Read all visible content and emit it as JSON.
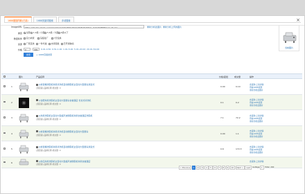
{
  "dialog": {
    "title": "选择数据",
    "close": "×"
  },
  "tabs": [
    "1688图搜同款(已选)",
    "1688关键词搜索",
    "手动搜索"
  ],
  "form": {
    "image_label": "ImageURL",
    "image_url": "https://cbu01.alicdn.com/img/ibank/O1CN01pNAhnR1Bq6cDfgm_!!2216786811-0-cib.jpg",
    "image_links": [
      "重新分析此图片",
      "重新分析上传的图片"
    ],
    "category_label": "类目",
    "category_options": [
      "全部",
      "1-2级 / 小图",
      "3-4级 / 大图",
      "4级以下"
    ],
    "filter_label": "筛选条件",
    "filter_options": [
      "实力商家",
      "深度验厂",
      "7天包换"
    ],
    "supply_label": "货源",
    "supply_options": [
      "厂家直供",
      "一件代发",
      "支持混批",
      "已开通跨境"
    ],
    "price_label": "价格",
    "price_from": "0",
    "price_to": "999",
    "price_ranges": [
      "0.01-0.50",
      "0.51-1.00",
      "1.01-5.00",
      "5.01-20.00",
      "20.01-50.00"
    ],
    "search_button": "搜索",
    "reset_link": "+ 1688高级搜索"
  },
  "preview": {
    "caption": "当前图片"
  },
  "table": {
    "headers": [
      "图片",
      "产品名称",
      "价格/起批",
      "成交量",
      "操作"
    ],
    "rows": [
      {
        "index": "1",
        "title": "[]前置桶洗碗机商用清洗机自动刷碗机全自动大型厨房通道式",
        "sub": "[源店铺] 品牌名称  成交量: 0",
        "price": "0.00",
        "qty": "0.10",
        "actions": [
          "去采购 上架详情",
          "查看1688货源",
          "重新分析此图片"
        ]
      },
      {
        "index": "2",
        "title": "[]合肥商用洗碗机全自动大型厨房食堂酒店 长龙式清洗机",
        "sub": "[源店铺] 品牌名称  成交量: 0",
        "price": "0.1",
        "qty": "0.2",
        "actions": [
          "去采购 上架详情",
          "查看1688货源",
          "重新分析此图片"
        ]
      },
      {
        "index": "3",
        "title": "[]商用洗碗机全自动大型超声波刷碗机商用食堂酒店洗碗机",
        "sub": "[源店铺] 品牌名称  成交量: 0",
        "price": "7.1",
        "qty": "72.2",
        "actions": [
          "去采购 上架详情",
          "查看1688货源",
          "重新分析此图片"
        ]
      },
      {
        "index": "4",
        "title": "[]前置桶洗碗机商用清洗机自动刷碗机全自动大型厨房",
        "sub": "[源店铺] 品牌名称  成交量: 0",
        "price": "0.00",
        "qty": "1.1",
        "actions": [
          "去采购 上架详情",
          "查看1688货源",
          "重新分析此图片"
        ]
      },
      {
        "index": "5",
        "title": "[]前置桶洗碗机商用清洗机自动刷碗机全自动大型厨房通道式",
        "sub": "[源店铺] 品牌名称  成交量: 0",
        "price": "0.6",
        "qty": "172.3",
        "actions": [
          "去采购 上架详情",
          "查看1688货源",
          "重新分析此图片"
        ]
      },
      {
        "index": "6",
        "title": "[]供应商用洗碗机全自动大型超声波刷碗机商用食堂酒店",
        "sub": "[源店铺] 品牌名称  成交量: 0",
        "price": "",
        "qty": "",
        "actions": [
          "去采购 上架详情"
        ]
      }
    ]
  },
  "pager": {
    "prev": "< Previous",
    "pages": [
      "1",
      "2",
      "3",
      "4",
      "5",
      "6",
      "7",
      "8",
      "9",
      "10"
    ],
    "next": "Next >",
    "last": "Last",
    "goto_label": "GoPage",
    "goto_value": "1",
    "total": "Total: 200"
  }
}
